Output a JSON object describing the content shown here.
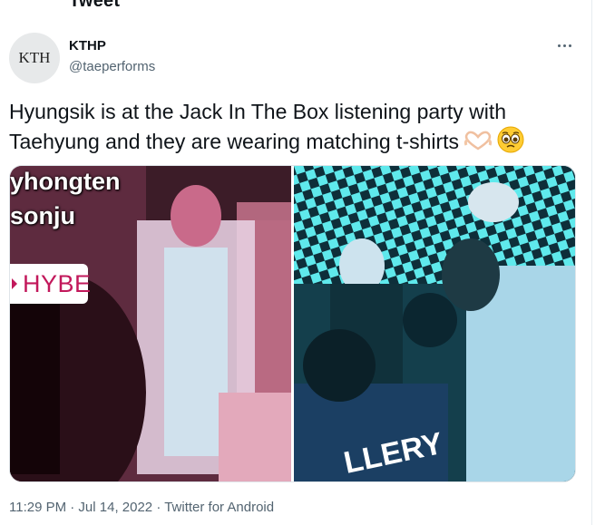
{
  "page": {
    "header_title": "Tweet"
  },
  "tweet": {
    "author": {
      "avatar_text": "KTH",
      "name": "KTHP",
      "handle": "@taeperforms"
    },
    "text_line1": "Hyungsik is at the Jack In The Box listening party with",
    "text_line2": "Taehyung and they are wearing matching t-shirts",
    "emojis": [
      "heart-hands-emoji",
      "pleading-face-emoji"
    ],
    "media": {
      "left": {
        "overlay_lines": [
          "yhongten",
          "sonju"
        ],
        "tag": "HYBE"
      },
      "right": {
        "shirt_text": "LLERY"
      }
    },
    "timestamp": "11:29 PM · Jul 14, 2022 · Twitter for Android"
  },
  "colors": {
    "accent_tag": "#c2185b",
    "meta_text": "#536471",
    "text": "#0f1419"
  }
}
